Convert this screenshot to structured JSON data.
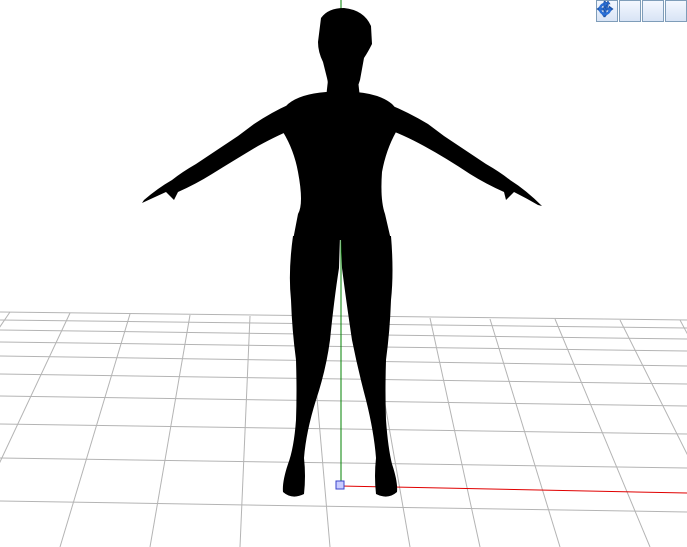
{
  "viewport": {
    "background": "#ffffff",
    "grid_color": "#b4b4b4",
    "axis_colors": {
      "x": "#e00000",
      "y": "#008000"
    },
    "silhouette_color": "#000000",
    "origin_marker_color": "#4a55d6"
  },
  "toolbar": {
    "buttons": [
      {
        "name": "pan-view-button",
        "icon": "move-arrows-icon",
        "color": "#2a6fd6"
      },
      {
        "name": "move-model-button",
        "icon": "move-cross-icon",
        "color": "#2a6fd6"
      },
      {
        "name": "zoom-button",
        "icon": "zoom-icon",
        "color": "#2a6fd6"
      },
      {
        "name": "rotate-button",
        "icon": "rotate-icon",
        "color": "#2a6fd6"
      }
    ]
  }
}
